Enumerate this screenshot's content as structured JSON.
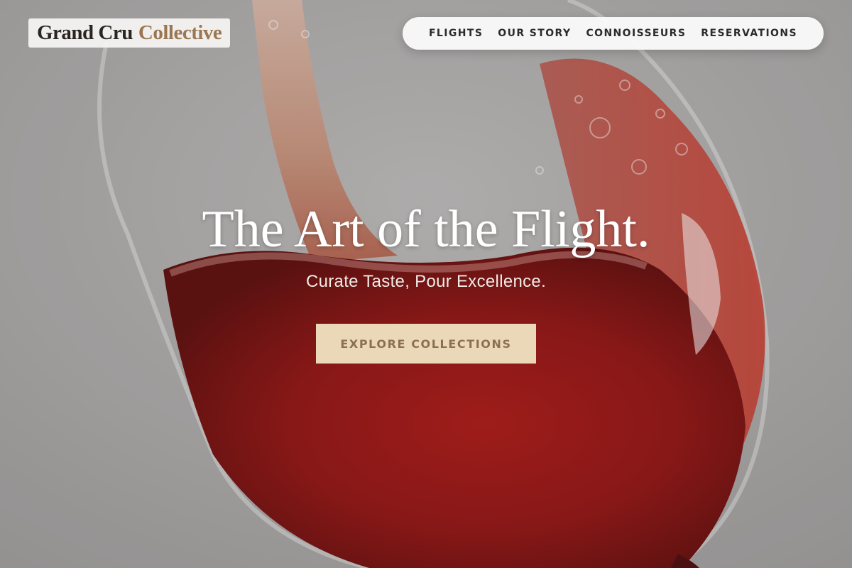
{
  "brand": {
    "name_part1": "Grand Cru",
    "name_part2": "Collective",
    "accent_color": "#9a7752"
  },
  "nav": {
    "items": [
      {
        "label": "FLIGHTS"
      },
      {
        "label": "OUR STORY"
      },
      {
        "label": "CONNOISSEURS"
      },
      {
        "label": "RESERVATIONS"
      }
    ]
  },
  "hero": {
    "title": "The Art of the Flight.",
    "subtitle": "Curate Taste, Pour Excellence.",
    "cta_label": "EXPLORE COLLECTIONS",
    "cta_color": "#ead8b9",
    "background_image": "red-wine-pouring-into-glass"
  }
}
